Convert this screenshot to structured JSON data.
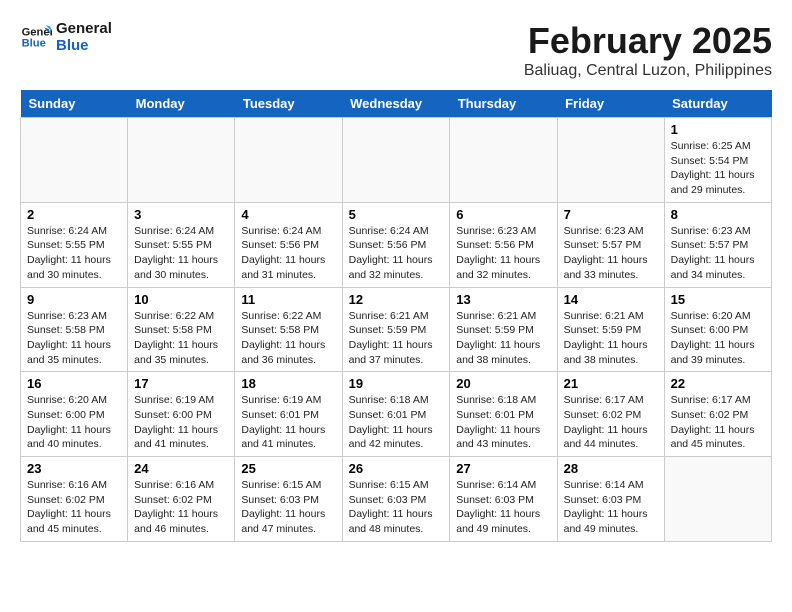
{
  "header": {
    "logo_line1": "General",
    "logo_line2": "Blue",
    "month": "February 2025",
    "location": "Baliuag, Central Luzon, Philippines"
  },
  "weekdays": [
    "Sunday",
    "Monday",
    "Tuesday",
    "Wednesday",
    "Thursday",
    "Friday",
    "Saturday"
  ],
  "weeks": [
    [
      {
        "day": "",
        "info": ""
      },
      {
        "day": "",
        "info": ""
      },
      {
        "day": "",
        "info": ""
      },
      {
        "day": "",
        "info": ""
      },
      {
        "day": "",
        "info": ""
      },
      {
        "day": "",
        "info": ""
      },
      {
        "day": "1",
        "info": "Sunrise: 6:25 AM\nSunset: 5:54 PM\nDaylight: 11 hours\nand 29 minutes."
      }
    ],
    [
      {
        "day": "2",
        "info": "Sunrise: 6:24 AM\nSunset: 5:55 PM\nDaylight: 11 hours\nand 30 minutes."
      },
      {
        "day": "3",
        "info": "Sunrise: 6:24 AM\nSunset: 5:55 PM\nDaylight: 11 hours\nand 30 minutes."
      },
      {
        "day": "4",
        "info": "Sunrise: 6:24 AM\nSunset: 5:56 PM\nDaylight: 11 hours\nand 31 minutes."
      },
      {
        "day": "5",
        "info": "Sunrise: 6:24 AM\nSunset: 5:56 PM\nDaylight: 11 hours\nand 32 minutes."
      },
      {
        "day": "6",
        "info": "Sunrise: 6:23 AM\nSunset: 5:56 PM\nDaylight: 11 hours\nand 32 minutes."
      },
      {
        "day": "7",
        "info": "Sunrise: 6:23 AM\nSunset: 5:57 PM\nDaylight: 11 hours\nand 33 minutes."
      },
      {
        "day": "8",
        "info": "Sunrise: 6:23 AM\nSunset: 5:57 PM\nDaylight: 11 hours\nand 34 minutes."
      }
    ],
    [
      {
        "day": "9",
        "info": "Sunrise: 6:23 AM\nSunset: 5:58 PM\nDaylight: 11 hours\nand 35 minutes."
      },
      {
        "day": "10",
        "info": "Sunrise: 6:22 AM\nSunset: 5:58 PM\nDaylight: 11 hours\nand 35 minutes."
      },
      {
        "day": "11",
        "info": "Sunrise: 6:22 AM\nSunset: 5:58 PM\nDaylight: 11 hours\nand 36 minutes."
      },
      {
        "day": "12",
        "info": "Sunrise: 6:21 AM\nSunset: 5:59 PM\nDaylight: 11 hours\nand 37 minutes."
      },
      {
        "day": "13",
        "info": "Sunrise: 6:21 AM\nSunset: 5:59 PM\nDaylight: 11 hours\nand 38 minutes."
      },
      {
        "day": "14",
        "info": "Sunrise: 6:21 AM\nSunset: 5:59 PM\nDaylight: 11 hours\nand 38 minutes."
      },
      {
        "day": "15",
        "info": "Sunrise: 6:20 AM\nSunset: 6:00 PM\nDaylight: 11 hours\nand 39 minutes."
      }
    ],
    [
      {
        "day": "16",
        "info": "Sunrise: 6:20 AM\nSunset: 6:00 PM\nDaylight: 11 hours\nand 40 minutes."
      },
      {
        "day": "17",
        "info": "Sunrise: 6:19 AM\nSunset: 6:00 PM\nDaylight: 11 hours\nand 41 minutes."
      },
      {
        "day": "18",
        "info": "Sunrise: 6:19 AM\nSunset: 6:01 PM\nDaylight: 11 hours\nand 41 minutes."
      },
      {
        "day": "19",
        "info": "Sunrise: 6:18 AM\nSunset: 6:01 PM\nDaylight: 11 hours\nand 42 minutes."
      },
      {
        "day": "20",
        "info": "Sunrise: 6:18 AM\nSunset: 6:01 PM\nDaylight: 11 hours\nand 43 minutes."
      },
      {
        "day": "21",
        "info": "Sunrise: 6:17 AM\nSunset: 6:02 PM\nDaylight: 11 hours\nand 44 minutes."
      },
      {
        "day": "22",
        "info": "Sunrise: 6:17 AM\nSunset: 6:02 PM\nDaylight: 11 hours\nand 45 minutes."
      }
    ],
    [
      {
        "day": "23",
        "info": "Sunrise: 6:16 AM\nSunset: 6:02 PM\nDaylight: 11 hours\nand 45 minutes."
      },
      {
        "day": "24",
        "info": "Sunrise: 6:16 AM\nSunset: 6:02 PM\nDaylight: 11 hours\nand 46 minutes."
      },
      {
        "day": "25",
        "info": "Sunrise: 6:15 AM\nSunset: 6:03 PM\nDaylight: 11 hours\nand 47 minutes."
      },
      {
        "day": "26",
        "info": "Sunrise: 6:15 AM\nSunset: 6:03 PM\nDaylight: 11 hours\nand 48 minutes."
      },
      {
        "day": "27",
        "info": "Sunrise: 6:14 AM\nSunset: 6:03 PM\nDaylight: 11 hours\nand 49 minutes."
      },
      {
        "day": "28",
        "info": "Sunrise: 6:14 AM\nSunset: 6:03 PM\nDaylight: 11 hours\nand 49 minutes."
      },
      {
        "day": "",
        "info": ""
      }
    ]
  ]
}
